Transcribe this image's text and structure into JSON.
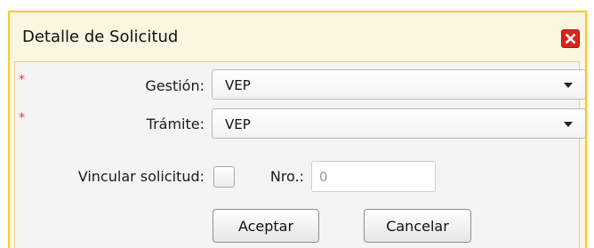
{
  "dialog": {
    "title": "Detalle de Solicitud",
    "close_icon": "close-icon",
    "accent_color": "#f5cc2e",
    "close_color": "#d8261c"
  },
  "form": {
    "required_marker": "*",
    "gestion": {
      "label": "Gestión:",
      "value": "VEP"
    },
    "tramite": {
      "label": "Trámite:",
      "value": "VEP"
    },
    "vincular": {
      "label": "Vincular solicitud:",
      "checked": false
    },
    "nro": {
      "label": "Nro.:",
      "value": "0"
    }
  },
  "buttons": {
    "accept": "Aceptar",
    "cancel": "Cancelar"
  }
}
